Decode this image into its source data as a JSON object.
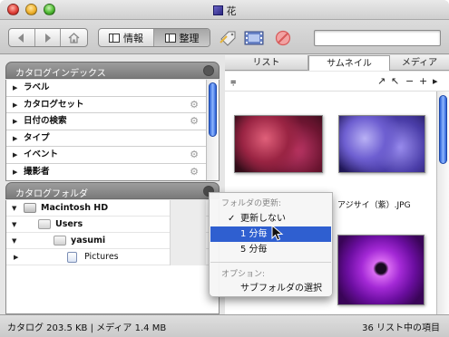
{
  "window": {
    "title": "花"
  },
  "toolbar": {
    "nav_back_icon": "back-arrow-icon",
    "nav_forward_icon": "forward-arrow-icon",
    "nav_home_icon": "home-icon",
    "info_label": "情報",
    "organize_label": "整理",
    "search_value": ""
  },
  "catalog_index": {
    "header": "カタログインデックス",
    "items": [
      {
        "label": "ラベル",
        "gear": false
      },
      {
        "label": "カタログセット",
        "gear": true
      },
      {
        "label": "日付の検索",
        "gear": true
      },
      {
        "label": "タイプ",
        "gear": false
      },
      {
        "label": "イベント",
        "gear": true
      },
      {
        "label": "撮影者",
        "gear": true
      }
    ]
  },
  "catalog_folders": {
    "header": "カタログフォルダ",
    "rows": [
      {
        "label": "Macintosh HD",
        "bold": true
      },
      {
        "label": "Users",
        "bold": true
      },
      {
        "label": "yasumi",
        "bold": true
      },
      {
        "label": "Pictures",
        "bold": false
      }
    ]
  },
  "tabs": [
    "リスト",
    "サムネイル",
    "メディア"
  ],
  "active_tab": "サムネイル",
  "thumbnails": {
    "caption_visible": "アジサイ（紫）.JPG"
  },
  "popup_menu": {
    "header1": "フォルダの更新:",
    "items": [
      "更新しない",
      "1 分毎",
      "5 分毎"
    ],
    "checked_item": "更新しない",
    "highlighted_item": "1 分毎",
    "header2": "オプション:",
    "option": "サブフォルダの選択"
  },
  "status": {
    "left": "カタログ  203.5 KB | メディア 1.4 MB",
    "right": "36 リスト中の項目"
  }
}
